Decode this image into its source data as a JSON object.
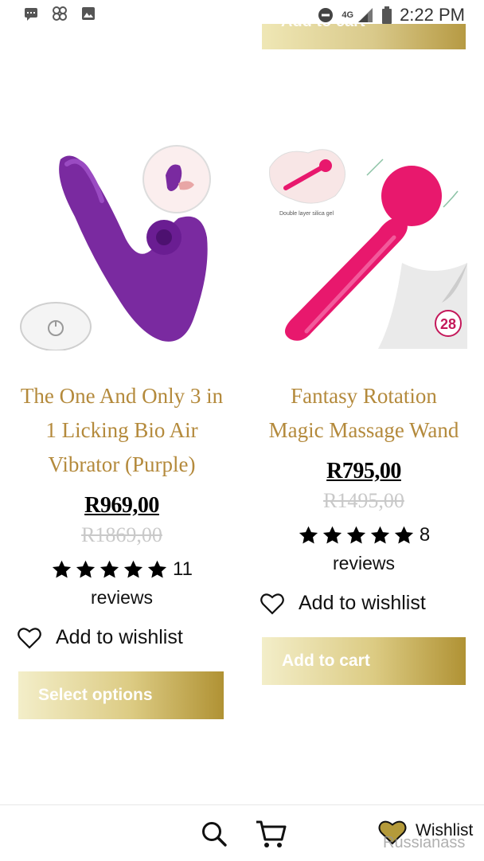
{
  "status_bar": {
    "time": "2:22 PM",
    "network": "4G",
    "icons_left": [
      "message-icon",
      "pinwheel-icon",
      "image-icon"
    ],
    "icons_right": [
      "do-not-disturb-icon",
      "signal-icon",
      "battery-icon"
    ]
  },
  "top_partial_button": {
    "label": "Add to cart"
  },
  "products": [
    {
      "title": "The One And Only 3 in 1 Licking Bio Air Vibrator (Purple)",
      "price": "R969,00",
      "old_price": "R1869,00",
      "rating_stars": 5,
      "review_count": "11",
      "reviews_word": "reviews",
      "wishlist_label": "Add to wishlist",
      "button_label": "Select options",
      "image_color": "#7a2aa0"
    },
    {
      "title": "Fantasy Rotation Magic Massage Wand",
      "price": "R795,00",
      "old_price": "R1495,00",
      "rating_stars": 5,
      "review_count": "8",
      "reviews_word": "reviews",
      "wishlist_label": "Add to wishlist",
      "button_label": "Add to cart",
      "image_color": "#e8186d",
      "image_caption": "Double layer silica gel",
      "badge_number": "28"
    }
  ],
  "bottom_bar": {
    "wishlist_label": "Wishlist",
    "watermark": "Russianass"
  },
  "colors": {
    "title_gold": "#b48a3c",
    "button_gradient_start": "#f3eec9",
    "button_gradient_end": "#b09234",
    "old_price_gray": "#c9c9c9"
  }
}
